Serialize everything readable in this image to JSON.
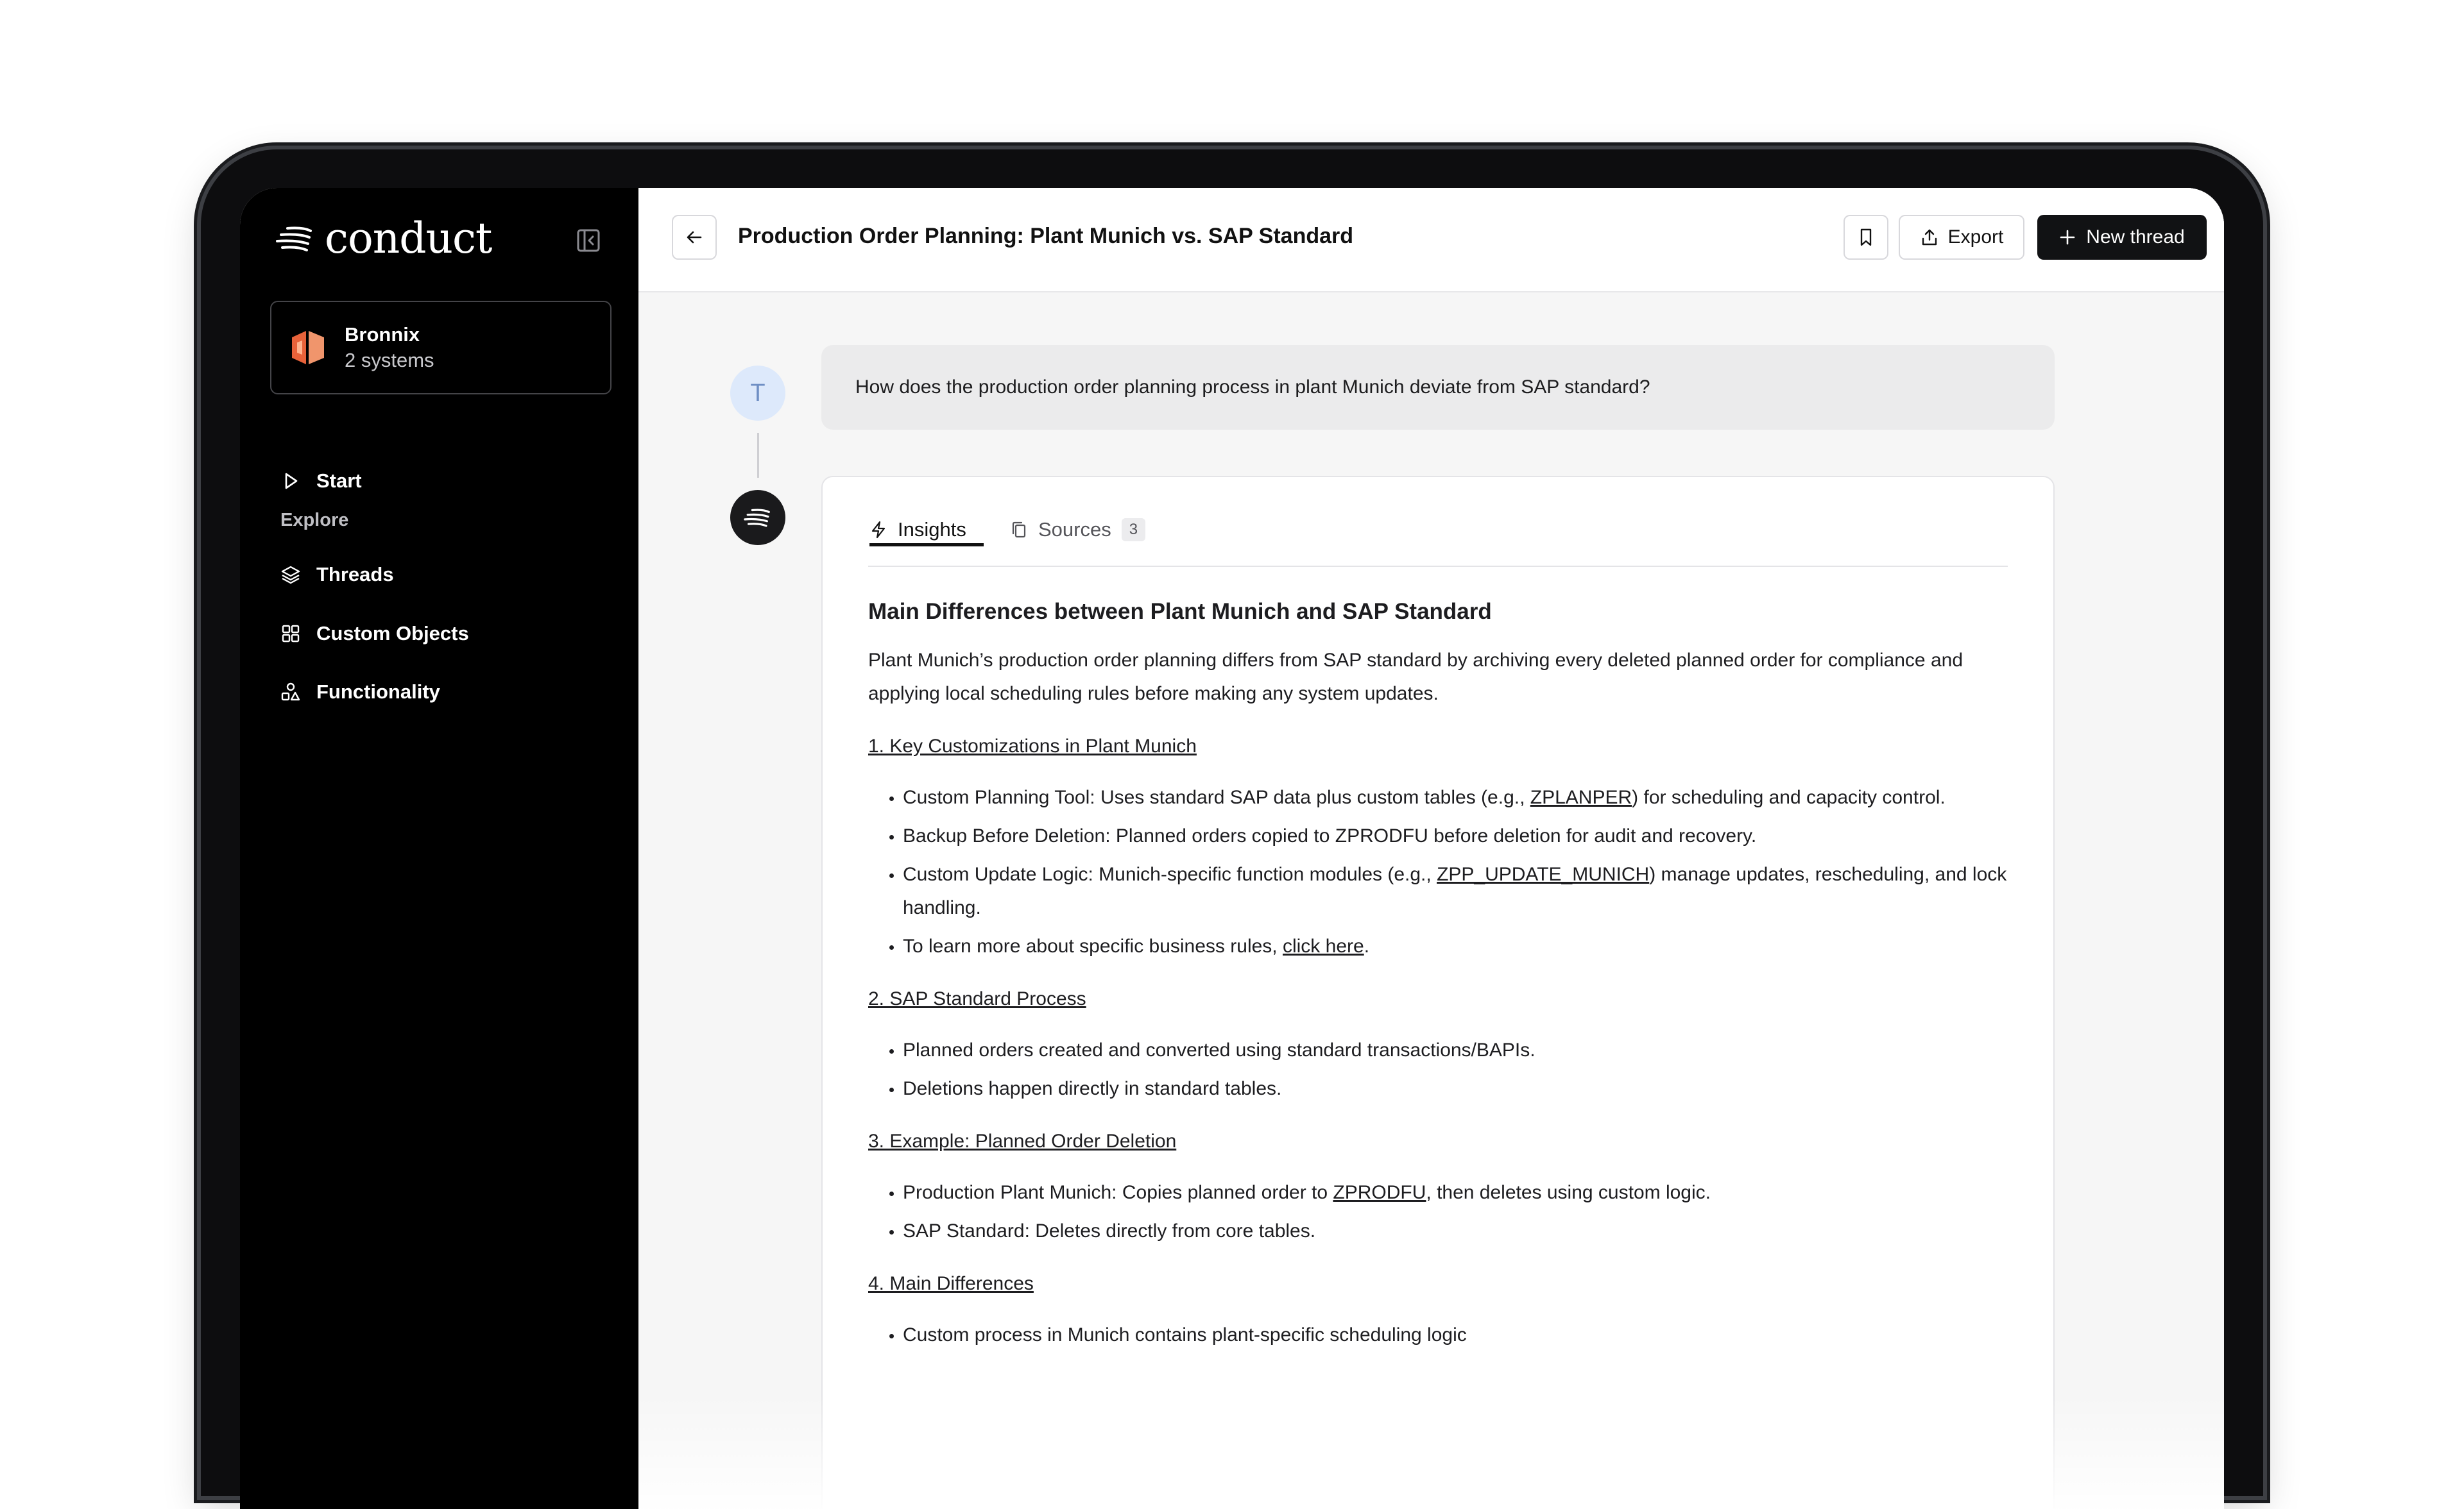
{
  "sidebar": {
    "logo_text": "conduct",
    "org": {
      "name": "Bronnix",
      "subtitle": "2 systems"
    },
    "start_label": "Start",
    "section_label": "Explore",
    "items": [
      {
        "label": "Threads",
        "icon": "layers-icon"
      },
      {
        "label": "Custom Objects",
        "icon": "grid-icon"
      },
      {
        "label": "Functionality",
        "icon": "shapes-icon"
      }
    ]
  },
  "header": {
    "title": "Production Order Planning: Plant Munich vs. SAP Standard",
    "export_label": "Export",
    "new_thread_label": "New thread"
  },
  "thread": {
    "user_initial": "T",
    "question": "How does the production order planning process in plant Munich deviate from SAP standard?"
  },
  "answer": {
    "tabs": [
      {
        "label": "Insights",
        "icon": "bolt-icon"
      },
      {
        "label": "Sources",
        "icon": "copy-icon",
        "count": "3"
      }
    ],
    "heading": "Main Differences between Plant Munich and SAP Standard",
    "intro": "Plant Munich’s production order planning differs from SAP standard by archiving every deleted planned order for compliance and applying local scheduling rules before making any system updates.",
    "s1": {
      "title": "1. Key Customizations in Plant Munich",
      "b1_pre": "Custom Planning Tool: Uses standard SAP data plus custom tables (e.g., ",
      "b1_link": "ZPLANPER",
      "b1_post": ") for scheduling and capacity control.",
      "b2": "Backup Before Deletion: Planned orders copied to ZPRODFU before deletion for audit and recovery.",
      "b3_pre": "Custom Update Logic: Munich-specific function modules (e.g., ",
      "b3_link": "ZPP_UPDATE_MUNICH",
      "b3_post": ") manage updates, rescheduling, and lock handling.",
      "b4_pre": "To learn more about specific business rules, ",
      "b4_link": "click here",
      "b4_post": "."
    },
    "s2": {
      "title": "2. SAP Standard Process",
      "b1": "Planned orders created and converted using standard transactions/BAPIs.",
      "b2": "Deletions happen directly in standard tables."
    },
    "s3": {
      "title": "3. Example: Planned Order Deletion",
      "b1_pre": "Production Plant Munich: Copies planned order to ",
      "b1_link": "ZPRODFU",
      "b1_post": ", then deletes using custom logic.",
      "b2": "SAP Standard: Deletes directly from core tables."
    },
    "s4": {
      "title": "4. Main Differences",
      "b1": "Custom process in Munich contains plant-specific scheduling logic"
    }
  }
}
